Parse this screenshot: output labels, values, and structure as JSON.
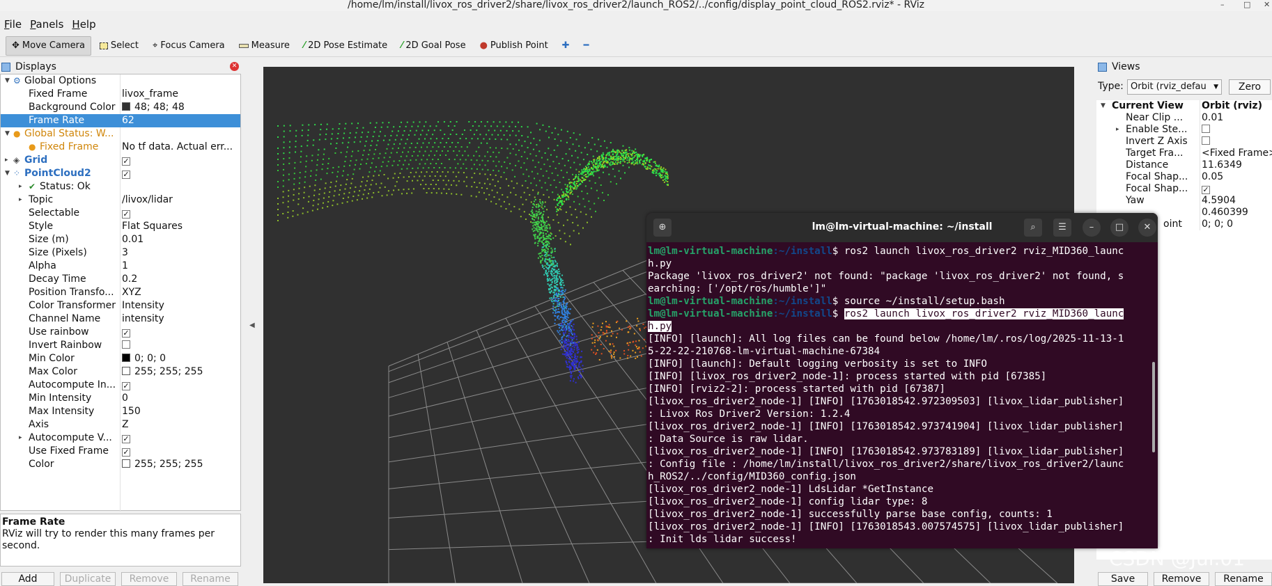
{
  "window": {
    "title": "/home/lm/install/livox_ros_driver2/share/livox_ros_driver2/launch_ROS2/../config/display_point_cloud_ROS2.rviz* - RViz"
  },
  "menu": [
    "File",
    "Panels",
    "Help"
  ],
  "toolbar": [
    {
      "label": "Move Camera",
      "icon": "move-camera-icon"
    },
    {
      "label": "Select",
      "icon": "select-icon"
    },
    {
      "label": "Focus Camera",
      "icon": "focus-camera-icon"
    },
    {
      "label": "Measure",
      "icon": "measure-icon"
    },
    {
      "label": "2D Pose Estimate",
      "icon": "pose-estimate-icon"
    },
    {
      "label": "2D Goal Pose",
      "icon": "goal-pose-icon"
    },
    {
      "label": "Publish Point",
      "icon": "publish-point-icon"
    }
  ],
  "displays": {
    "title": "Displays",
    "rows": [
      {
        "k": "Global Options",
        "v": ""
      },
      {
        "k": "Fixed Frame",
        "v": "livox_frame"
      },
      {
        "k": "Background Color",
        "v": "48; 48; 48"
      },
      {
        "k": "Frame Rate",
        "v": "62"
      },
      {
        "k": "Global Status: W...",
        "v": ""
      },
      {
        "k": "Fixed Frame",
        "v": "No tf data.  Actual err..."
      },
      {
        "k": "Grid",
        "v": ""
      },
      {
        "k": "PointCloud2",
        "v": ""
      },
      {
        "k": "Status: Ok",
        "v": ""
      },
      {
        "k": "Topic",
        "v": "/livox/lidar"
      },
      {
        "k": "Selectable",
        "v": ""
      },
      {
        "k": "Style",
        "v": "Flat Squares"
      },
      {
        "k": "Size (m)",
        "v": "0.01"
      },
      {
        "k": "Size (Pixels)",
        "v": "3"
      },
      {
        "k": "Alpha",
        "v": "1"
      },
      {
        "k": "Decay Time",
        "v": "0.2"
      },
      {
        "k": "Position Transfo...",
        "v": "XYZ"
      },
      {
        "k": "Color Transformer",
        "v": "Intensity"
      },
      {
        "k": "Channel Name",
        "v": "intensity"
      },
      {
        "k": "Use rainbow",
        "v": ""
      },
      {
        "k": "Invert Rainbow",
        "v": ""
      },
      {
        "k": "Min Color",
        "v": "0; 0; 0"
      },
      {
        "k": "Max Color",
        "v": "255; 255; 255"
      },
      {
        "k": "Autocompute In...",
        "v": ""
      },
      {
        "k": "Min Intensity",
        "v": "0"
      },
      {
        "k": "Max Intensity",
        "v": "150"
      },
      {
        "k": "Axis",
        "v": "Z"
      },
      {
        "k": "Autocompute V...",
        "v": ""
      },
      {
        "k": "Use Fixed Frame",
        "v": ""
      },
      {
        "k": "Color",
        "v": "255; 255; 255"
      }
    ],
    "desc_title": "Frame Rate",
    "desc_text": "RViz will try to render this many frames per second.",
    "buttons": [
      "Add",
      "Duplicate",
      "Remove",
      "Rename"
    ]
  },
  "views": {
    "title": "Views",
    "type_label": "Type:",
    "type_value": "Orbit (rviz_defau",
    "zero": "Zero",
    "rows": [
      {
        "k": "Current View",
        "v": "Orbit (rviz)"
      },
      {
        "k": "Near Clip ...",
        "v": "0.01"
      },
      {
        "k": "Enable Ste...",
        "v": ""
      },
      {
        "k": "Invert Z Axis",
        "v": ""
      },
      {
        "k": "Target Fra...",
        "v": "<Fixed Frame>"
      },
      {
        "k": "Distance",
        "v": "11.6349"
      },
      {
        "k": "Focal Shap...",
        "v": "0.05"
      },
      {
        "k": "Focal Shap...",
        "v": ""
      },
      {
        "k": "Yaw",
        "v": "4.5904"
      },
      {
        "k": "",
        "v": "0.460399"
      },
      {
        "k": "oint",
        "v": "0; 0; 0"
      }
    ],
    "buttons": [
      "Save",
      "Remove",
      "Rename"
    ]
  },
  "terminal": {
    "title": "lm@lm-virtual-machine: ~/install",
    "prompt_user": "lm@lm-virtual-machine",
    "prompt_dir": ":~/install",
    "lines": [
      "$ ros2 launch livox_ros_driver2 rviz_MID360_launc",
      "h.py",
      "Package 'livox_ros_driver2' not found: \"package 'livox_ros_driver2' not found, s",
      "earching: ['/opt/ros/humble']\"",
      "$ source ~/install/setup.bash",
      "ros2 launch livox_ros_driver2 rviz_MID360_launc",
      "h.py",
      "[INFO] [launch]: All log files can be found below /home/lm/.ros/log/2025-11-13-1",
      "5-22-22-210768-lm-virtual-machine-67384",
      "[INFO] [launch]: Default logging verbosity is set to INFO",
      "[INFO] [livox_ros_driver2_node-1]: process started with pid [67385]",
      "[INFO] [rviz2-2]: process started with pid [67387]",
      "[livox_ros_driver2_node-1] [INFO] [1763018542.972309503] [livox_lidar_publisher]",
      ": Livox Ros Driver2 Version: 1.2.4",
      "[livox_ros_driver2_node-1] [INFO] [1763018542.973741904] [livox_lidar_publisher]",
      ": Data Source is raw lidar.",
      "[livox_ros_driver2_node-1] [INFO] [1763018542.973783189] [livox_lidar_publisher]",
      ": Config file : /home/lm/install/livox_ros_driver2/share/livox_ros_driver2/launc",
      "h_ROS2/../config/MID360_config.json",
      "[livox_ros_driver2_node-1] LdsLidar *GetInstance",
      "[livox_ros_driver2_node-1] config lidar type: 8",
      "[livox_ros_driver2_node-1] successfully parse base config, counts: 1",
      "[livox_ros_driver2_node-1] [INFO] [1763018543.007574575] [livox_lidar_publisher]",
      ": Init lds lidar success!"
    ]
  },
  "watermark": "CSDN @Jul.01",
  "colors": {
    "background": "#303030",
    "selection": "#3d8fd8",
    "terminal_bg": "#300a24",
    "prompt_green": "#26a269",
    "prompt_blue": "#12488b"
  }
}
